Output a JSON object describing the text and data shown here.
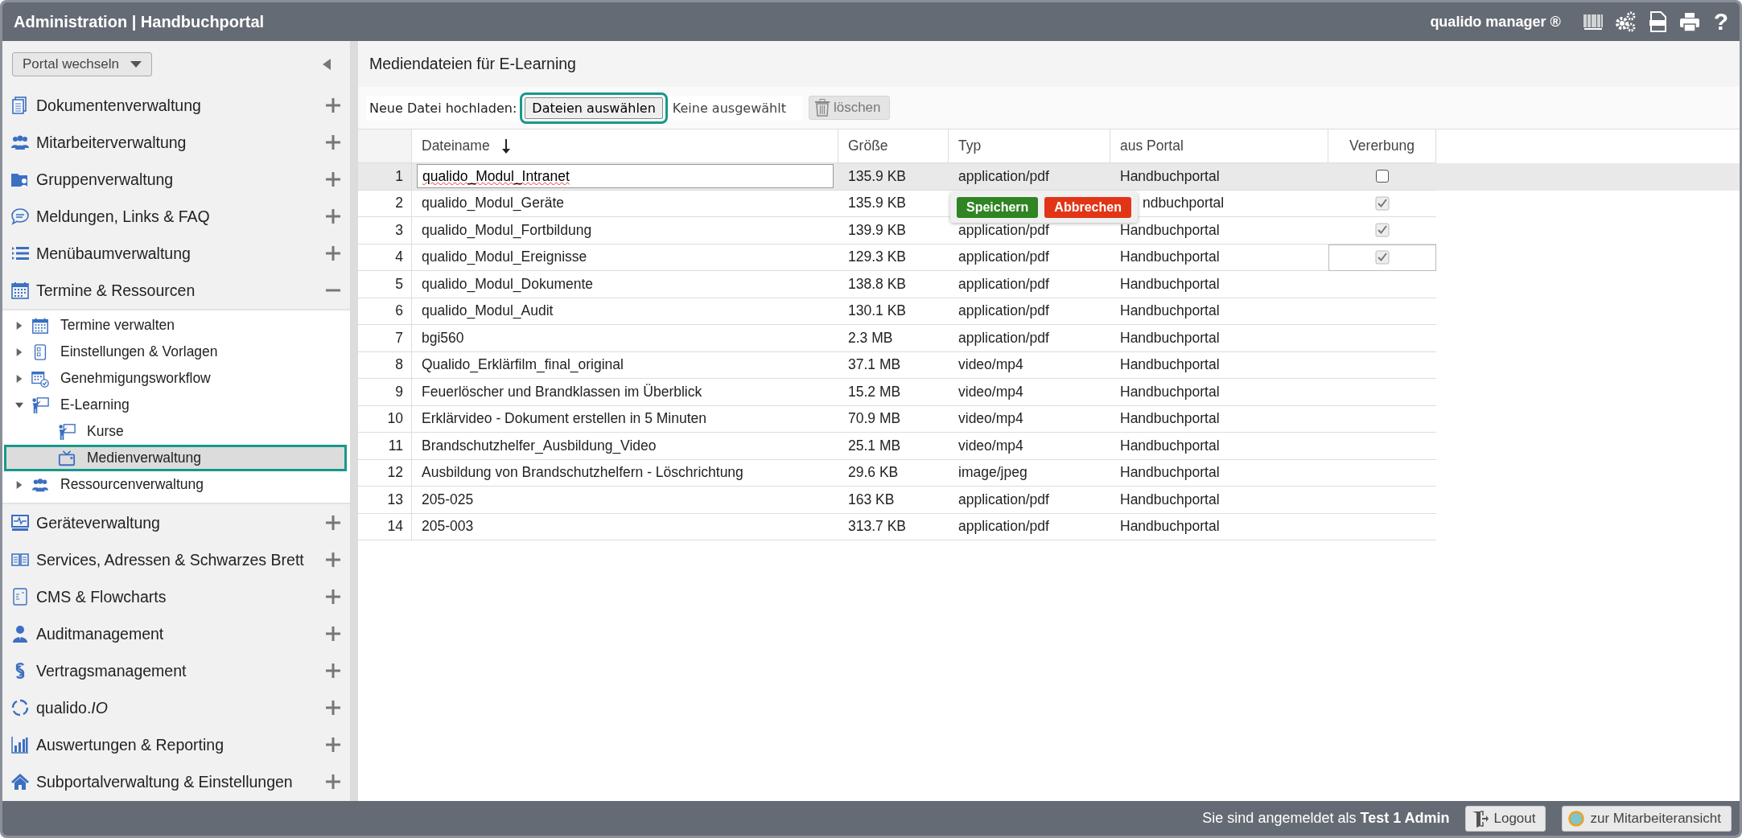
{
  "header": {
    "title": "Administration | Handbuchportal",
    "brand": "qualido manager ®",
    "help": "?"
  },
  "sidebar": {
    "portal_switch": "Portal wechseln",
    "sections": [
      {
        "label": "Dokumentenverwaltung",
        "expanded": false
      },
      {
        "label": "Mitarbeiterverwaltung",
        "expanded": false
      },
      {
        "label": "Gruppenverwaltung",
        "expanded": false
      },
      {
        "label": "Meldungen, Links & FAQ",
        "expanded": false
      },
      {
        "label": "Menübaumverwaltung",
        "expanded": false
      },
      {
        "label": "Termine & Ressourcen",
        "expanded": true,
        "children": [
          {
            "label": "Termine verwalten",
            "expanded": false
          },
          {
            "label": "Einstellungen & Vorlagen",
            "expanded": false
          },
          {
            "label": "Genehmigungsworkflow",
            "expanded": false
          },
          {
            "label": "E-Learning",
            "expanded": true,
            "children": [
              {
                "label": "Kurse",
                "selected": false
              },
              {
                "label": "Medienverwaltung",
                "selected": true
              }
            ]
          },
          {
            "label": "Ressourcenverwaltung",
            "expanded": false
          }
        ]
      },
      {
        "label": "Geräteverwaltung",
        "expanded": false
      },
      {
        "label": "Services, Adressen & Schwarzes Brett",
        "expanded": false
      },
      {
        "label": "CMS & Flowcharts",
        "expanded": false
      },
      {
        "label": "Auditmanagement",
        "expanded": false
      },
      {
        "label": "Vertragsmanagement",
        "expanded": false
      },
      {
        "label": "qualido.*IO*",
        "expanded": false
      },
      {
        "label": "Auswertungen & Reporting",
        "expanded": false
      },
      {
        "label": "Subportalverwaltung & Einstellungen",
        "expanded": false
      }
    ]
  },
  "main": {
    "title": "Mediendateien für E-Learning",
    "upload": {
      "label": "Neue Datei hochladen:",
      "button": "Dateien auswählen",
      "status": "Keine ausgewählt"
    },
    "delete_button": {
      "label": "löschen",
      "disabled": true
    },
    "table": {
      "columns": [
        {
          "label": "Dateiname",
          "sorted": true
        },
        {
          "label": "Größe",
          "sorted": false
        },
        {
          "label": "Typ",
          "sorted": false
        },
        {
          "label": "aus Portal",
          "sorted": false
        },
        {
          "label": "Vererbung",
          "sorted": false
        }
      ],
      "rows": [
        {
          "number": "1",
          "name": "qualido_Modul_Intranet",
          "size": "135.9 KB",
          "type": "application/pdf",
          "portal": "Handbuchportal",
          "editing": true,
          "inherited": false,
          "focused": false
        },
        {
          "number": "2",
          "name": "qualido_Modul_Geräte",
          "size": "135.9 KB",
          "portal": "ndbuchportal",
          "editing": false,
          "inherited": true,
          "focused": false,
          "popup": {
            "buttons": [
              {
                "label": "Speichern",
                "kind": "save"
              },
              {
                "label": "Abbrechen",
                "kind": "cancel"
              }
            ]
          }
        },
        {
          "number": "3",
          "name": "qualido_Modul_Fortbildung",
          "size": "139.9 KB",
          "type": "application/pdf",
          "portal": "Handbuchportal",
          "editing": false,
          "inherited": true,
          "focused": false
        },
        {
          "number": "4",
          "name": "qualido_Modul_Ereignisse",
          "size": "129.3 KB",
          "type": "application/pdf",
          "portal": "Handbuchportal",
          "editing": false,
          "inherited": true,
          "focused": true
        },
        {
          "number": "5",
          "name": "qualido_Modul_Dokumente",
          "size": "138.8 KB",
          "type": "application/pdf",
          "portal": "Handbuchportal",
          "editing": false
        },
        {
          "number": "6",
          "name": "qualido_Modul_Audit",
          "size": "130.1 KB",
          "type": "application/pdf",
          "portal": "Handbuchportal",
          "editing": false
        },
        {
          "number": "7",
          "name": "bgi560",
          "size": "2.3 MB",
          "type": "application/pdf",
          "portal": "Handbuchportal",
          "editing": false
        },
        {
          "number": "8",
          "name": "Qualido_Erklärfilm_final_original",
          "size": "37.1 MB",
          "type": "video/mp4",
          "portal": "Handbuchportal",
          "editing": false
        },
        {
          "number": "9",
          "name": "Feuerlöscher und Brandklassen im Überblick",
          "size": "15.2 MB",
          "type": "video/mp4",
          "portal": "Handbuchportal",
          "editing": false
        },
        {
          "number": "10",
          "name": "Erklärvideo - Dokument erstellen in 5 Minuten",
          "size": "70.9 MB",
          "type": "video/mp4",
          "portal": "Handbuchportal",
          "editing": false
        },
        {
          "number": "11",
          "name": "Brandschutzhelfer_Ausbildung_Video",
          "size": "25.1 MB",
          "type": "video/mp4",
          "portal": "Handbuchportal",
          "editing": false
        },
        {
          "number": "12",
          "name": "Ausbildung von Brandschutzhelfern - Löschrichtung",
          "size": "29.6 KB",
          "type": "image/jpeg",
          "portal": "Handbuchportal",
          "editing": false
        },
        {
          "number": "13",
          "name": "205-025",
          "size": "163 KB",
          "type": "application/pdf",
          "portal": "Handbuchportal",
          "editing": false
        },
        {
          "number": "14",
          "name": "205-003",
          "size": "313.7 KB",
          "type": "application/pdf",
          "portal": "Handbuchportal",
          "editing": false
        }
      ]
    }
  },
  "footer": {
    "login_text": "Sie sind angemeldet als **Test 1 Admin**",
    "logout": "Logout",
    "employee_view": "zur Mitarbeiteransicht"
  }
}
